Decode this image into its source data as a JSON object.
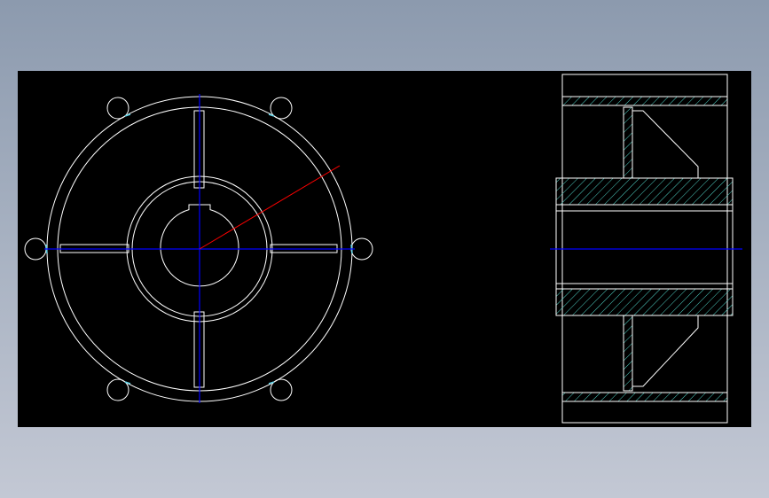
{
  "drawing": {
    "background": "#000000",
    "colors": {
      "outline": "#ffffff",
      "center_line": "#0000ff",
      "leader_line": "#ff0000",
      "hatch": "#4fd1c5",
      "highlight": "#5fd3e8"
    },
    "views": [
      "front-view",
      "section-view"
    ]
  }
}
